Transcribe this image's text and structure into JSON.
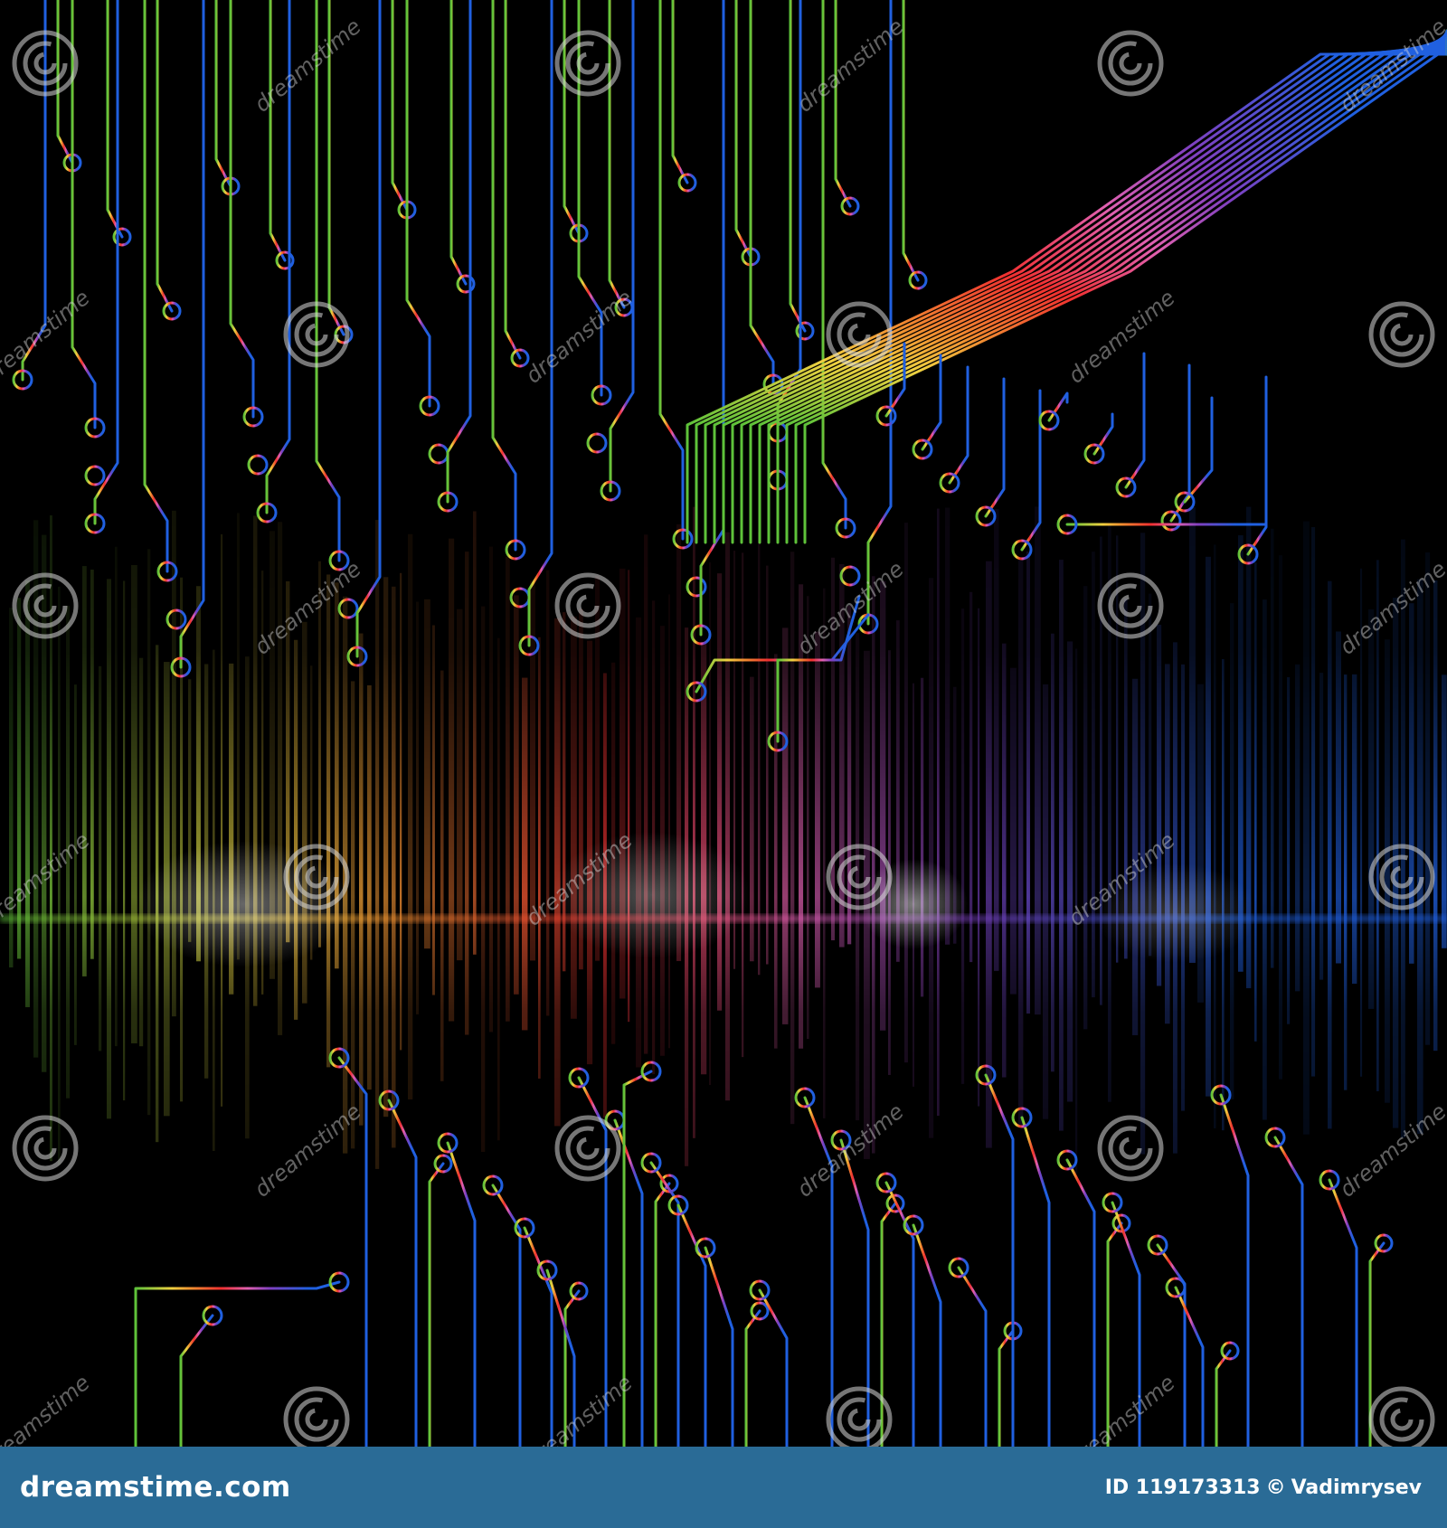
{
  "footer": {
    "site_name": "dreamstime.com",
    "image_id": "ID 119173313",
    "copyright_symbol": "©",
    "author": "Vadimrysev"
  },
  "watermark": {
    "text": "dreamstime",
    "icon": "spiral-logo-icon"
  },
  "colors": {
    "footer_bar": "#2a6b96",
    "background": "#000000",
    "green": "#5ec23a",
    "yellow": "#f0d040",
    "orange": "#f08a30",
    "red": "#f03030",
    "pink": "#e060b0",
    "purple": "#8040c0",
    "blue": "#2060e0"
  }
}
